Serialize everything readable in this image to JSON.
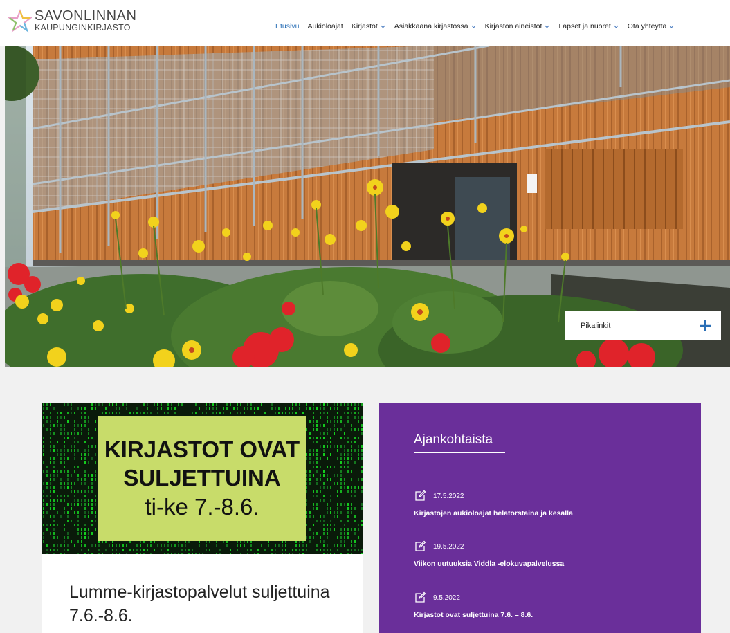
{
  "brand": {
    "line1": "SAVONLINNAN",
    "line2": "KAUPUNGINKIRJASTO"
  },
  "nav": {
    "items": [
      {
        "label": "Etusivu",
        "active": true,
        "dropdown": false
      },
      {
        "label": "Aukioloajat",
        "active": false,
        "dropdown": false
      },
      {
        "label": "Kirjastot",
        "active": false,
        "dropdown": true
      },
      {
        "label": "Asiakkaana kirjastossa",
        "active": false,
        "dropdown": true
      },
      {
        "label": "Kirjaston aineistot",
        "active": false,
        "dropdown": true
      },
      {
        "label": "Lapset ja nuoret",
        "active": false,
        "dropdown": true
      },
      {
        "label": "Ota yhteyttä",
        "active": false,
        "dropdown": true
      }
    ],
    "active_color": "#2a6fb6"
  },
  "hero": {
    "quicklinks_label": "Pikalinkit",
    "quicklinks_icon": "plus-icon"
  },
  "feature": {
    "notice_line1": "KIRJASTOT OVAT",
    "notice_line2": "SULJETTUINA",
    "notice_line3": "ti-ke 7.-8.6.",
    "title": "Lumme-kirjastopalvelut suljettuina 7.6.-8.6."
  },
  "news": {
    "heading": "Ajankohtaista",
    "background": "#6a2f9a",
    "items": [
      {
        "date": "17.5.2022",
        "title": "Kirjastojen aukioloajat helatorstaina ja kesällä"
      },
      {
        "date": "19.5.2022",
        "title": "Viikon uutuuksia Viddla -elokuvapalvelussa"
      },
      {
        "date": "9.5.2022",
        "title": "Kirjastot ovat suljettuina 7.6. – 8.6."
      }
    ]
  }
}
